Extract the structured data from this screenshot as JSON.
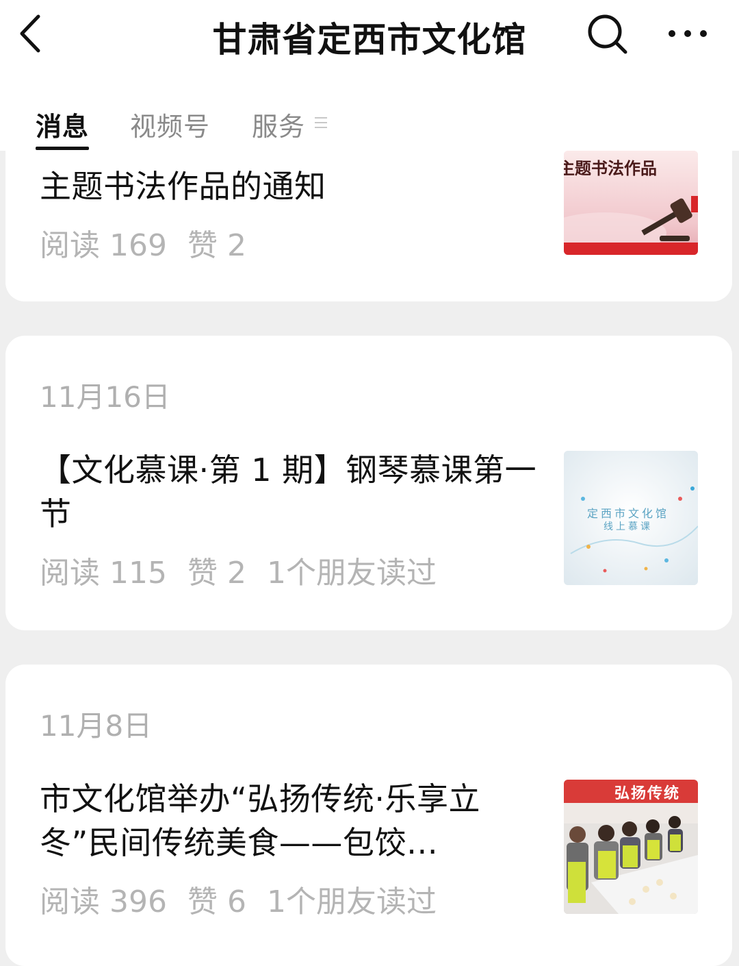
{
  "header": {
    "title": "甘肃省定西市文化馆"
  },
  "tabs": [
    {
      "label": "消息"
    },
    {
      "label": "视频号"
    },
    {
      "label": "服务"
    }
  ],
  "articles": [
    {
      "date": "",
      "title": "主题书法作品的通知",
      "reads": "阅读 169",
      "likes": "赞 2",
      "friends": "",
      "thumb_text": "主题书法作品"
    },
    {
      "date": "11月16日",
      "title": "【文化慕课·第 1 期】钢琴慕课第一节",
      "reads": "阅读 115",
      "likes": "赞 2",
      "friends": "1个朋友读过",
      "thumb_text_1": "定西市文化馆",
      "thumb_text_2": "线上慕课"
    },
    {
      "date": "11月8日",
      "title": "市文化馆举办“弘扬传统·乐享立冬”民间传统美食——包饺…",
      "reads": "阅读 396",
      "likes": "赞 6",
      "friends": "1个朋友读过",
      "thumb_text": "弘扬传统"
    }
  ],
  "colors": {
    "background": "#efefef",
    "card": "#ffffff",
    "meta_text": "#b4b4b4",
    "title_text": "#111111"
  }
}
